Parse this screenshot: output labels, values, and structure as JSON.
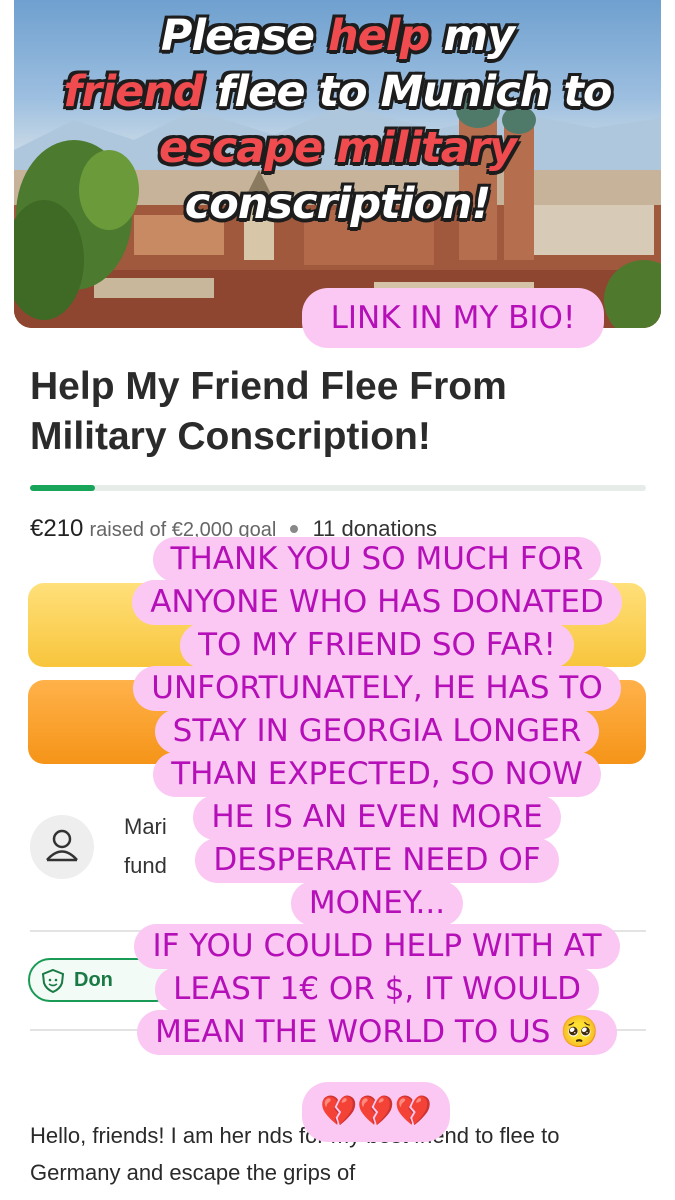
{
  "hero": {
    "headline_parts": [
      {
        "text": "Please ",
        "color": "white"
      },
      {
        "text": "help",
        "color": "red"
      },
      {
        "text": " my ",
        "color": "white"
      },
      {
        "text": "friend",
        "color": "red"
      },
      {
        "text": " flee to Munich to ",
        "color": "white"
      },
      {
        "text": "escape military",
        "color": "red"
      },
      {
        "text": " conscription!",
        "color": "white"
      }
    ]
  },
  "stickers": {
    "bio_link": "LINK IN MY BIO!",
    "message_lines": [
      "THANK YOU SO MUCH FOR",
      "ANYONE WHO HAS DONATED",
      "TO MY FRIEND SO FAR!",
      "UNFORTUNATELY, HE HAS TO",
      "STAY IN GEORGIA LONGER",
      "THAN EXPECTED, SO NOW",
      "HE IS AN EVEN MORE",
      "DESPERATE NEED OF",
      "MONEY...",
      "IF YOU COULD HELP WITH AT",
      "LEAST 1€ OR $, IT WOULD",
      "MEAN THE WORLD TO US 🥺"
    ],
    "hearts": "💔💔💔"
  },
  "campaign": {
    "title": "Help My Friend Flee From Military Conscription!",
    "raised": "€210",
    "raised_suffix": "raised of €2,000 goal",
    "donations": "11 donations",
    "progress_fraction": 0.105,
    "organizer_name": "Mari",
    "organizer_sub": "fund",
    "badge_label": "Don",
    "body_text": "Hello, friends! I am her                  nds for my best friend to flee to Germany and escape the grips of"
  },
  "colors": {
    "accent_green": "#18a55a",
    "sticker_pink": "#fbc8f4",
    "sticker_text": "#b510b8",
    "share_button": "#f8c53c",
    "donate_button": "#f59418"
  }
}
